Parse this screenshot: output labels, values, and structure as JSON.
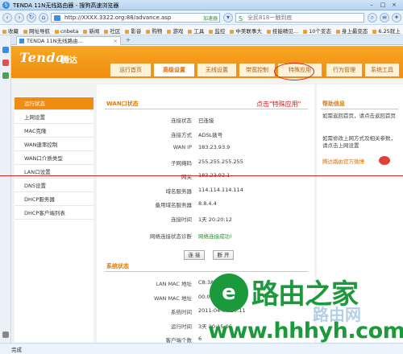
{
  "browser": {
    "title": "TENDA 11N无线路由器 - 搜狗高速浏览器",
    "url": "http://XXXX.3322.org:88/advance.asp",
    "accel_label": "加速器",
    "search_placeholder": "全民818一触到底",
    "bookmarks": [
      "收藏",
      "网址导航",
      "cnbeta",
      "新闻",
      "社区",
      "影音",
      "购物",
      "游戏",
      "工具",
      "监控",
      "中美联事大",
      "技能精见...",
      "10个变态",
      "身上最变态",
      "6.25就上"
    ],
    "tab_title": "TENDA 11N无线路由...",
    "status": "完成"
  },
  "router": {
    "brand": "Tenda",
    "brand_cn": "腾达",
    "tabs": [
      "运行首页",
      "高级设置",
      "无线设置",
      "带宽控制",
      "特殊应用",
      "行为管理",
      "系统工具"
    ],
    "active_tab": 1,
    "menu": [
      "运行状态",
      "上网设置",
      "MAC克隆",
      "WAN速率控制",
      "WAN口介质类型",
      "LAN口设置",
      "DNS设置",
      "DHCP服务器",
      "DHCP客户端列表"
    ],
    "active_menu": 0,
    "wan_title": "WAN口状态",
    "wan_rows": [
      {
        "label": "连接状态",
        "value": "已连接"
      },
      {
        "label": "连接方式",
        "value": "ADSL拨号"
      },
      {
        "label": "WAN IP",
        "value": "183.23.93.9"
      },
      {
        "label": "子网掩码",
        "value": "255.255.255.255"
      },
      {
        "label": "网关",
        "value": "183.23.92.1"
      },
      {
        "label": "域名服务器",
        "value": "114.114.114.114"
      },
      {
        "label": "备用域名服务器",
        "value": "8.8.4.4"
      },
      {
        "label": "连接时间",
        "value": "1天 20:20:12"
      }
    ],
    "detect_label": "网络连接状态诊断",
    "detect_value": "网络连接成功!",
    "btn_connect": "连 接",
    "btn_disconnect": "断 开",
    "sys_title": "系统状态",
    "sys_rows": [
      {
        "label": "LAN MAC 地址",
        "value": "C8:3A:35:38:F2"
      },
      {
        "label": "WAN MAC 地址",
        "value": "00:00:31:00:00"
      },
      {
        "label": "系统时间",
        "value": "2011-04-04 20:11"
      },
      {
        "label": "运行时间",
        "value": "3天 20:15:06"
      },
      {
        "label": "客户端个数",
        "value": "6"
      }
    ],
    "help_title": "帮助信息",
    "help_p1": "如需返回首页，请点击返回首页",
    "help_p2": "如需修改上网方式及相关参数，请点击上网设置",
    "weibo_label": "腾达路由官方微博"
  },
  "annotation": "点击\"特殊应用\"",
  "watermark": {
    "logo": "e",
    "text": "路由之家",
    "url": "www.hhhyh.com",
    "faint": "路由网"
  },
  "colors": {
    "accent": "#f08c10",
    "annotation": "#d02020",
    "watermark": "#1a9a3a"
  }
}
